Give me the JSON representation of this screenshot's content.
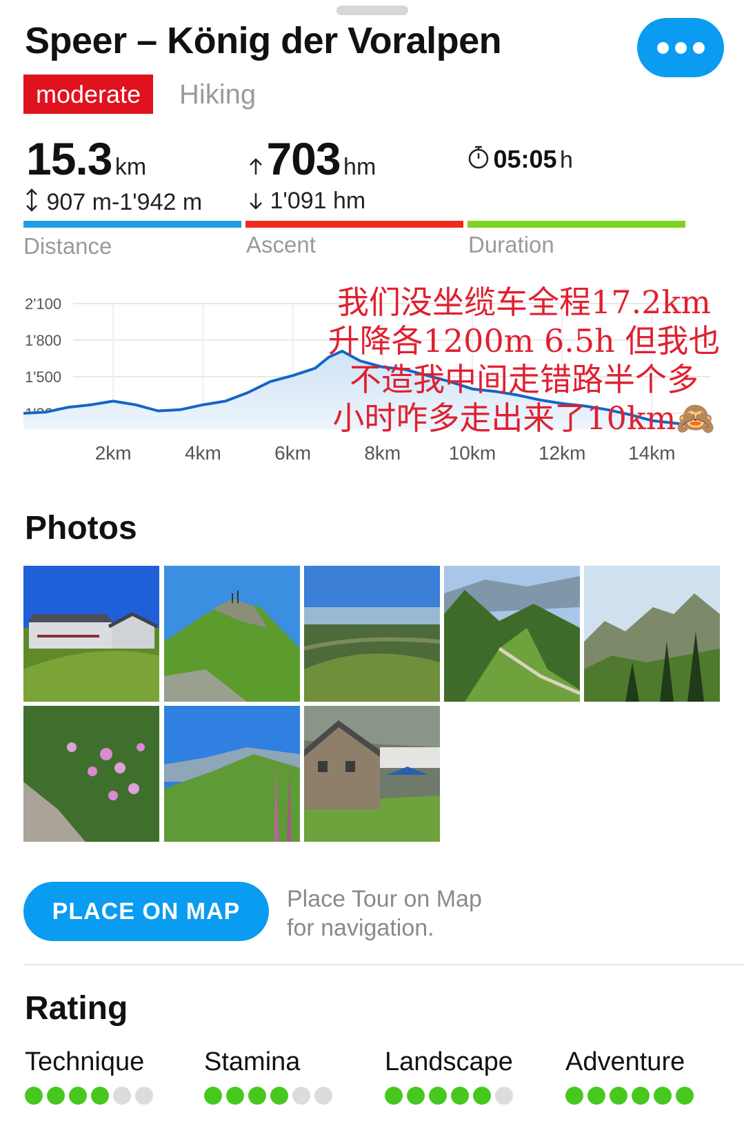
{
  "header": {
    "title": "Speer – König der Voralpen",
    "difficulty": "moderate",
    "category": "Hiking",
    "colors": {
      "accent": "#0a9cf0",
      "difficulty": "#e0121d"
    }
  },
  "stats": {
    "distance": {
      "value": "15.3",
      "unit": "km",
      "range": "907 m-1'942 m",
      "label": "Distance",
      "color": "#1f9ee8"
    },
    "ascent": {
      "value": "703",
      "unit": "hm",
      "descent": "1'091 hm",
      "label": "Ascent",
      "color": "#ef2b1c"
    },
    "duration": {
      "value": "05:05",
      "unit": "h",
      "label": "Duration",
      "color": "#7ed321"
    }
  },
  "chart_data": {
    "type": "area",
    "title": "",
    "xlabel": "",
    "ylabel": "",
    "x_ticks": [
      "2km",
      "4km",
      "6km",
      "8km",
      "10km",
      "12km",
      "14km"
    ],
    "y_ticks": [
      "2'100",
      "1'800",
      "1'500",
      "1'200"
    ],
    "x_unit": "km",
    "y_unit": "m",
    "xlim": [
      0,
      15.3
    ],
    "ylim": [
      1070,
      2100
    ],
    "grid": true,
    "series": [
      {
        "x": [
          0,
          0.5,
          1.0,
          1.5,
          2.0,
          2.5,
          3.0,
          3.5,
          4.0,
          4.5,
          5.0,
          5.5,
          6.0,
          6.5,
          6.8,
          7.1,
          7.5,
          8.0,
          8.5,
          9.0,
          9.5,
          10.0,
          10.5,
          11.0,
          11.5,
          12.0,
          12.5,
          13.0,
          13.5,
          14.0,
          14.5,
          15.0,
          15.3
        ],
        "y": [
          1200,
          1210,
          1250,
          1270,
          1300,
          1270,
          1220,
          1230,
          1270,
          1300,
          1370,
          1460,
          1510,
          1570,
          1660,
          1710,
          1630,
          1580,
          1560,
          1510,
          1460,
          1400,
          1380,
          1350,
          1310,
          1280,
          1260,
          1230,
          1190,
          1140,
          1120,
          1100,
          1080
        ]
      }
    ]
  },
  "annotation": {
    "lines": [
      "我们没坐缆车全程17.2km",
      "升降各1200m 6.5h 但我也",
      "不造我中间走错路半个多",
      "小时咋多走出来了10km🙈"
    ]
  },
  "photos": {
    "title": "Photos",
    "items": [
      {
        "icon": "mountain-hut-photo"
      },
      {
        "icon": "summit-ridge-photo"
      },
      {
        "icon": "valley-view-photo"
      },
      {
        "icon": "ridge-trail-photo"
      },
      {
        "icon": "rock-peaks-photo"
      },
      {
        "icon": "pink-flowers-photo"
      },
      {
        "icon": "wildflower-meadow-photo"
      },
      {
        "icon": "alpine-inn-photo"
      }
    ]
  },
  "map": {
    "button_label": "PLACE ON MAP",
    "line1": "Place Tour on Map",
    "line2": "for navigation."
  },
  "rating": {
    "title": "Rating",
    "items": [
      {
        "label": "Technique",
        "score": 4,
        "max": 6
      },
      {
        "label": "Stamina",
        "score": 4,
        "max": 6
      },
      {
        "label": "Landscape",
        "score": 5,
        "max": 6
      },
      {
        "label": "Adventure",
        "score": 6,
        "max": 6
      }
    ]
  }
}
